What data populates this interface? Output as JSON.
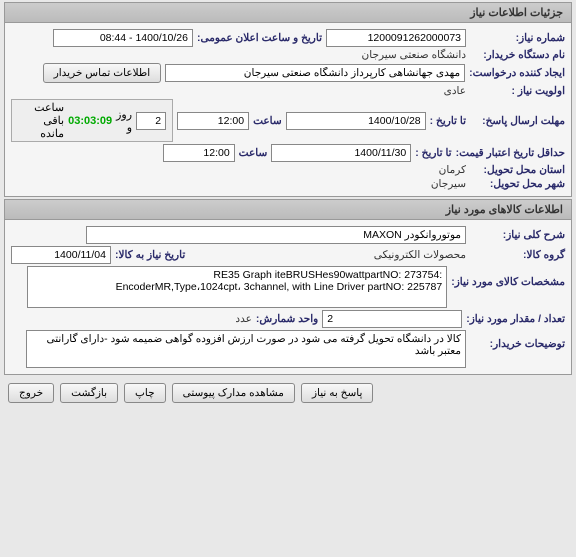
{
  "panel1": {
    "title": "جزئیات اطلاعات نیاز",
    "need_no_label": "شماره نیاز:",
    "need_no": "1200091262000073",
    "announce_label": "تاریخ و ساعت اعلان عمومی:",
    "announce_value": "1400/10/26 - 08:44",
    "buyer_label": "نام دستگاه خریدار:",
    "buyer": "دانشگاه صنعتی سیرجان",
    "creator_label": "ایجاد کننده درخواست:",
    "creator": "مهدی جهانشاهی کارپرداز دانشگاه صنعتی سیرجان",
    "contact_btn": "اطلاعات تماس خریدار",
    "priority_label": "اولویت نیاز :",
    "priority": "عادی",
    "deadline_label": "مهلت ارسال پاسخ:",
    "to_date_label": "تا تاریخ :",
    "deadline_date": "1400/10/28",
    "time_label": "ساعت",
    "deadline_time": "12:00",
    "remain_days": "2",
    "remain_days_label": "روز و",
    "remain_time": "03:03:09",
    "remain_suffix": "ساعت باقی مانده",
    "price_valid_label": "حداقل تاریخ اعتبار قیمت:",
    "price_valid_date": "1400/11/30",
    "price_valid_time": "12:00",
    "province_label": "استان محل تحویل:",
    "province": "کرمان",
    "city_label": "شهر محل تحویل:",
    "city": "سیرجان"
  },
  "panel2": {
    "title": "اطلاعات کالاهای مورد نیاز",
    "desc_label": "شرح کلی نیاز:",
    "desc": "موتوروانکودر MAXON",
    "group_label": "گروه کالا:",
    "group": "محصولات الکترونیکی",
    "need_date_label": "تاریخ نیاز به کالا:",
    "need_date": "1400/11/04",
    "spec_label": "مشخصات کالای مورد نیاز:",
    "spec": ":RE35 Graph iteBRUSHes90wattpartNO: 273754\nEncoderMR,Type،1024cpt، 3channel, with Line Driver partNO: 225787",
    "qty_label": "تعداد / مقدار مورد نیاز:",
    "qty": "2",
    "unit_label": "واحد شمارش:",
    "unit": "عدد",
    "notes_label": "توضیحات خریدار:",
    "notes": "کالا در دانشگاه تحویل گرفته می شود در صورت ارزش افزوده گواهی ضمیمه شود -دارای گارانتی معتبر باشد"
  },
  "footer": {
    "reply": "پاسخ به نیاز",
    "attach": "مشاهده مدارک پیوستی",
    "print": "چاپ",
    "back": "بازگشت",
    "exit": "خروج"
  }
}
